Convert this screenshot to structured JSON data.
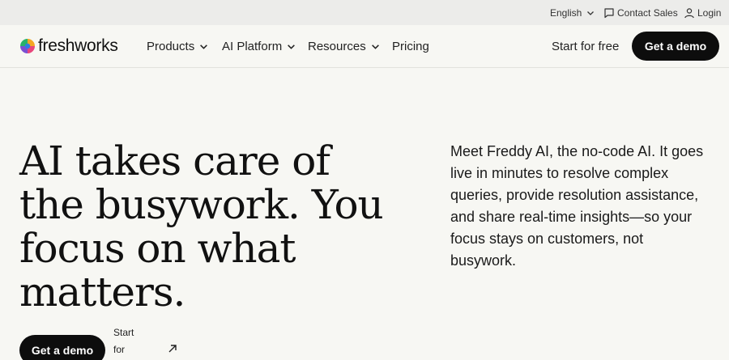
{
  "topbar": {
    "language": "English",
    "contact_sales": "Contact Sales",
    "login": "Login"
  },
  "nav": {
    "logo_text": "freshworks",
    "items": [
      {
        "label": "Products"
      },
      {
        "label": "AI Platform"
      },
      {
        "label": "Resources"
      },
      {
        "label": "Pricing"
      }
    ],
    "start_free": "Start for free",
    "demo": "Get a demo"
  },
  "hero": {
    "title_lines": [
      "AI takes care of",
      "the busywork. You",
      "focus on what",
      "matters."
    ],
    "description": "Meet Freddy AI, the no-code AI. It goes live in minutes to resolve complex queries, provide resolution assistance, and share real-time insights—so your focus stays on customers, not busywork.",
    "cta_demo": "Get a demo",
    "cta_start_lines": [
      "Start",
      "for"
    ]
  },
  "colors": {
    "background": "#f7f7f3",
    "topbar": "#ececea",
    "button": "#0d0d0d"
  },
  "icons": [
    "chevron-down-icon",
    "chat-bubble-icon",
    "user-icon",
    "arrow-up-right-icon",
    "freshworks-logo-icon"
  ]
}
